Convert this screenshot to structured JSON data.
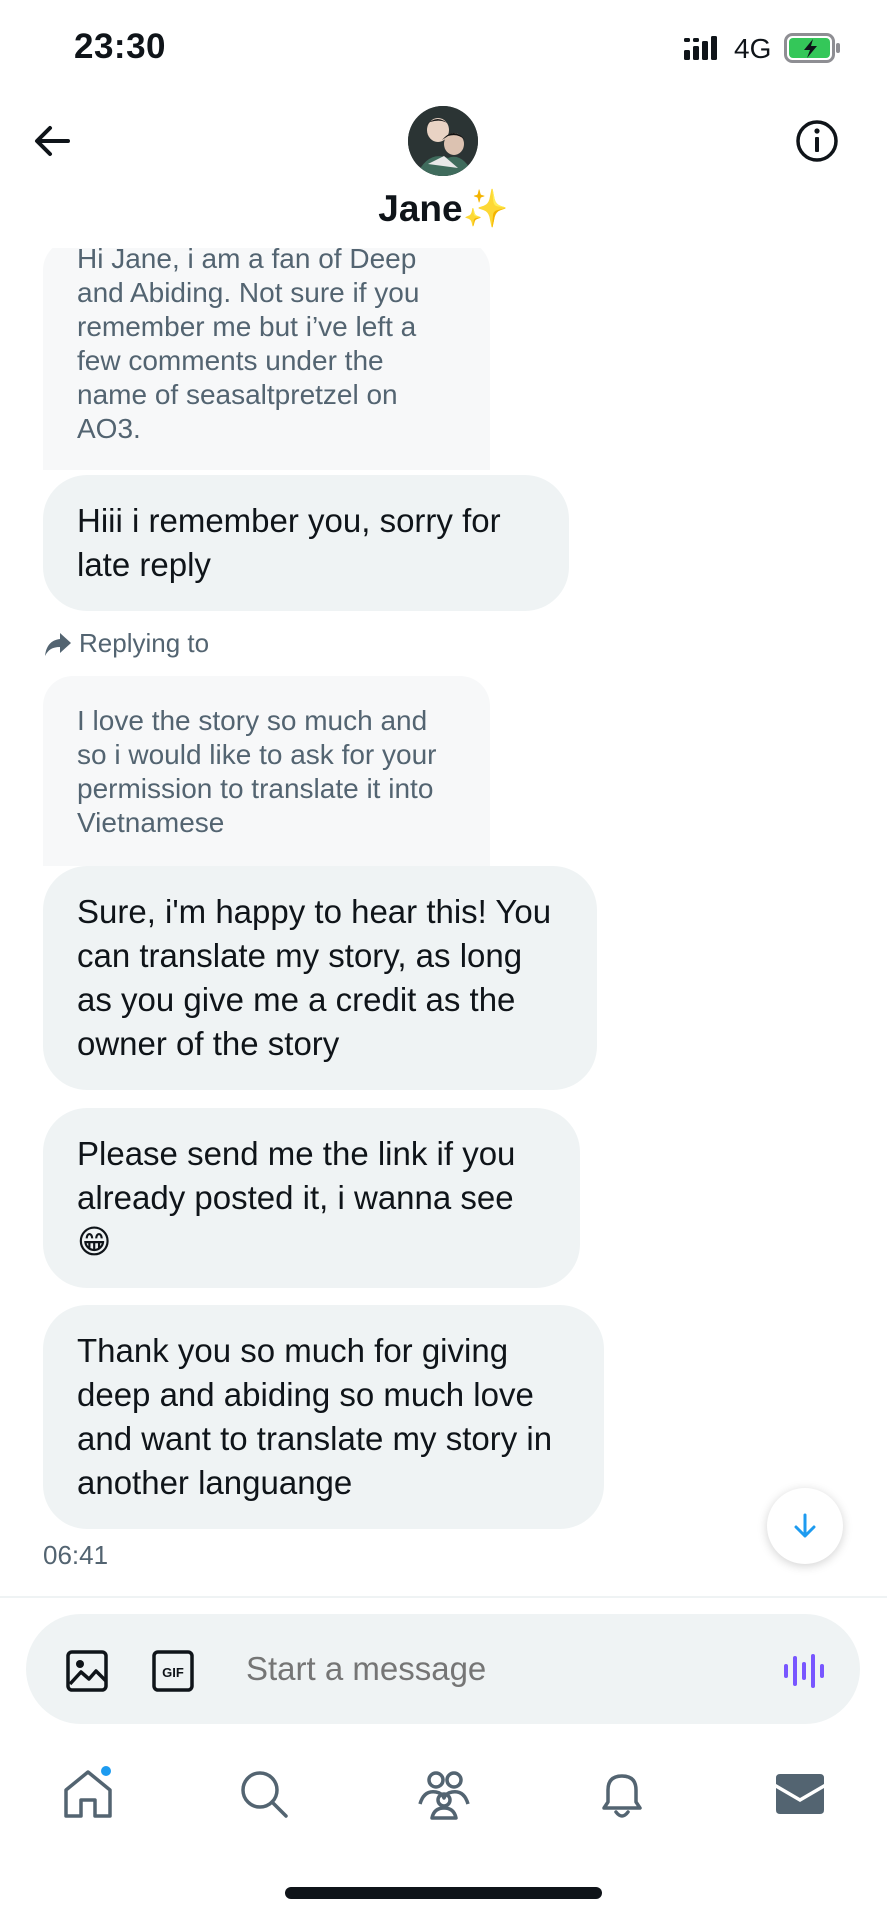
{
  "status_bar": {
    "time": "23:30",
    "network": "4G"
  },
  "header": {
    "name": "Jane",
    "emoji": "✨"
  },
  "messages": {
    "quoted_1": "Hi Jane, i am a fan of Deep and Abiding. Not sure if you remember me but i’ve left a few comments under the name of seasaltpretzel on AO3.",
    "reply_1": "Hiii i remember you, sorry for late reply",
    "replying_label": "Replying to",
    "quoted_2": "I love the story so much and so i would like to ask for your permission to translate it into Vietnamese",
    "reply_2": "Sure, i'm happy to hear this! You can translate my story, as long as you give me a credit as the owner of the story",
    "reply_3": "Please send me the link if you already posted it, i wanna see 😁",
    "reply_4": "Thank you so much for giving deep and abiding so much love and want to translate my story in another languange",
    "timestamp": "06:41"
  },
  "composer": {
    "placeholder": "Start a message"
  },
  "colors": {
    "accent": "#1d9bf0",
    "voice": "#7856ff",
    "bubble": "#eff3f4",
    "muted": "#536471"
  },
  "tabs": [
    "home-icon",
    "search-icon",
    "communities-icon",
    "notifications-icon",
    "messages-icon"
  ]
}
